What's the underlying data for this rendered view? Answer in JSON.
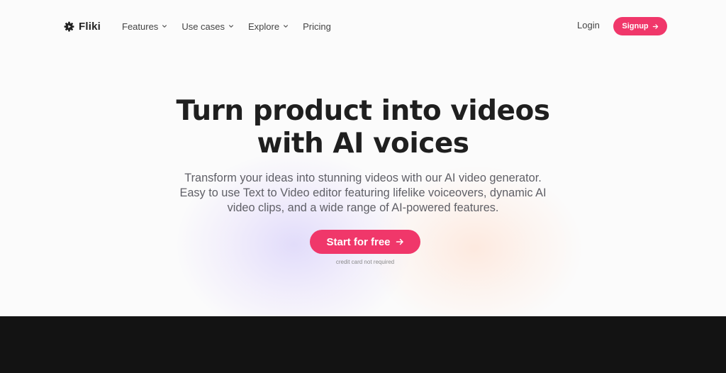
{
  "brand": {
    "name": "Fliki",
    "icon": "play-gear-icon"
  },
  "nav": {
    "items": [
      {
        "label": "Features",
        "has_dropdown": true
      },
      {
        "label": "Use cases",
        "has_dropdown": true
      },
      {
        "label": "Explore",
        "has_dropdown": true
      },
      {
        "label": "Pricing",
        "has_dropdown": false
      }
    ],
    "login_label": "Login",
    "signup_label": "Signup"
  },
  "hero": {
    "title_line1": "Turn product into videos",
    "title_line2": "with AI voices",
    "subtitle_line1": "Transform your ideas into stunning videos with our AI video generator.",
    "subtitle_line2": "Easy to use Text to Video editor featuring lifelike voiceovers, dynamic AI",
    "subtitle_line3": "video clips, and a wide range of AI-powered features.",
    "cta_label": "Start for free",
    "cta_note": "credit card not required"
  },
  "colors": {
    "accent": "#f0376a",
    "text_dark": "#1f1f1f",
    "band": "#131313"
  }
}
